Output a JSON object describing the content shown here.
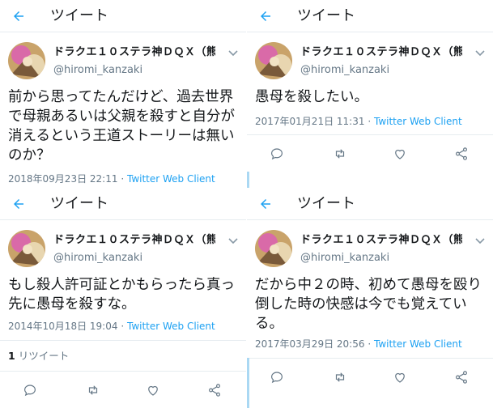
{
  "header_title": "ツイート",
  "account": {
    "display_name": "ドラクエ１０ステラ神ＤＱＸ（熊...",
    "handle": "@hiromi_kanzaki"
  },
  "client": "Twitter Web Client",
  "tweets": [
    {
      "text": "前から思ってたんだけど、過去世界で母親あるいは父親を殺すと自分が消えるという王道ストーリーは無いのか？",
      "date": "2018年09月23日 22:11"
    },
    {
      "text": "愚母を殺したい。",
      "date": "2017年01月21日 11:31"
    },
    {
      "text": "もし殺人許可証とかもらったら真っ先に愚母を殺すな。",
      "date": "2014年10月18日 19:04",
      "retweets": "1",
      "retweets_label": "リツイート"
    },
    {
      "text": "だから中２の時、初めて愚母を殴り倒した時の快感は今でも覚えている。",
      "date": "2017年03月29日 20:56"
    }
  ],
  "meta_separator": "·",
  "icons": [
    "back-arrow-icon",
    "avatar-icon",
    "chevron-down-icon",
    "reply-icon",
    "retweet-icon",
    "like-icon",
    "share-icon"
  ],
  "colors": {
    "accent": "#1da1f2",
    "secondary_text": "#657786",
    "border": "#e6ecf0"
  }
}
